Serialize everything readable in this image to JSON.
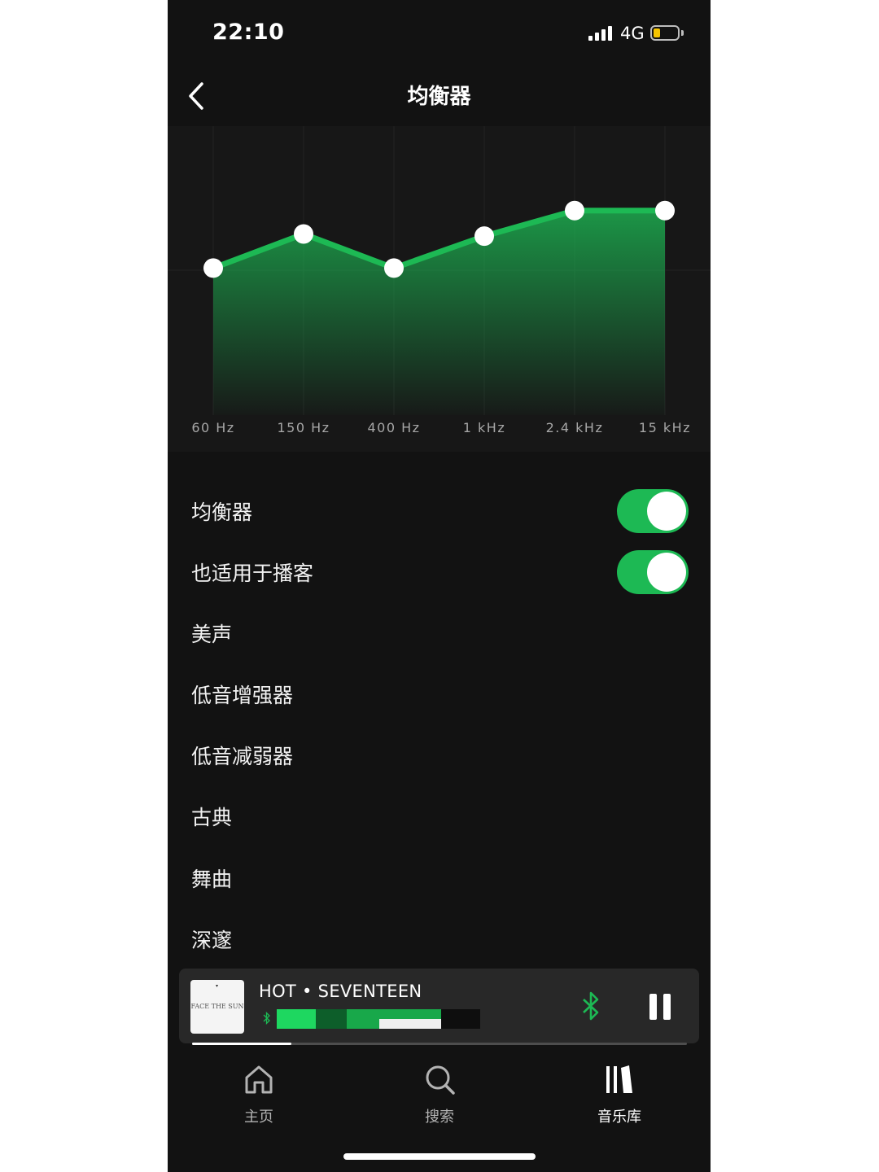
{
  "status_bar": {
    "time": "22:10",
    "network": "4G",
    "battery_level": 0.25
  },
  "header": {
    "title": "均衡器"
  },
  "chart_data": {
    "type": "line",
    "categories": [
      "60 Hz",
      "150 Hz",
      "400 Hz",
      "1 kHz",
      "2.4 kHz",
      "15 kHz"
    ],
    "values": [
      0.1,
      1.7,
      0.1,
      1.6,
      2.8,
      2.8
    ],
    "ylim": [
      -6,
      6
    ],
    "line_color": "#1db954",
    "fill": "gradient"
  },
  "settings": {
    "equalizer": {
      "label": "均衡器",
      "enabled": true
    },
    "podcasts": {
      "label": "也适用于播客",
      "enabled": true
    },
    "presets": [
      "美声",
      "低音增强器",
      "低音减弱器",
      "古典",
      "舞曲",
      "深邃"
    ]
  },
  "player": {
    "title": "HOT • SEVENTEEN",
    "album_art_text": "FACE THE SUN",
    "progress": 0.2,
    "accent_color": "#1db954"
  },
  "tabs": [
    {
      "label": "主页",
      "icon": "home-icon",
      "active": false
    },
    {
      "label": "搜索",
      "icon": "search-icon",
      "active": false
    },
    {
      "label": "音乐库",
      "icon": "library-icon",
      "active": true
    }
  ]
}
